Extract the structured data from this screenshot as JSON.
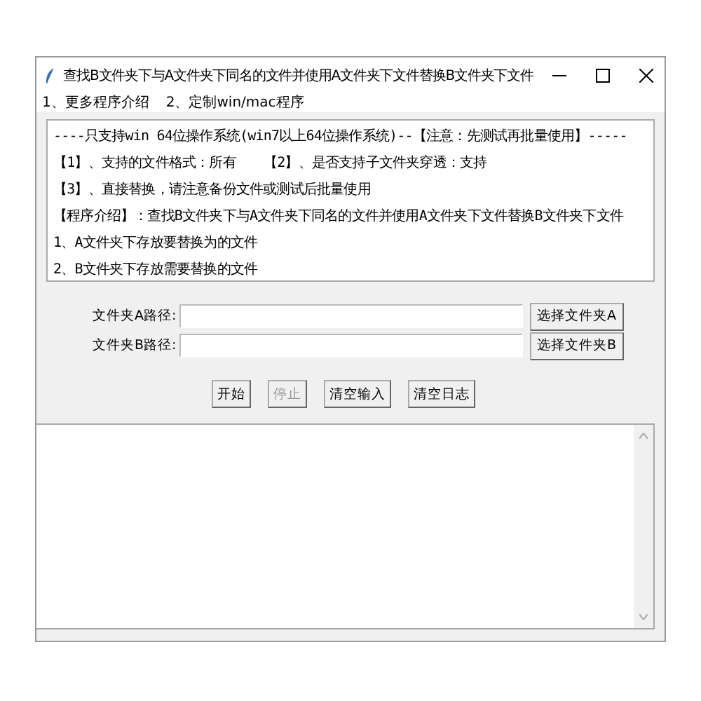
{
  "window": {
    "title": "查找B文件夹下与A文件夹下同名的文件并使用A文件夹下文件替换B文件夹下文件"
  },
  "menu": [
    "1、更多程序介绍",
    "2、定制win/mac程序"
  ],
  "info_lines": [
    "----只支持win 64位操作系统(win7以上64位操作系统)--【注意：先测试再批量使用】-----",
    "【1】、支持的文件格式：所有",
    "【3】、直接替换，请注意备份文件或测试后批量使用",
    "【程序介绍】：查找B文件夹下与A文件夹下同名的文件并使用A文件夹下文件替换B文件夹下文件",
    "1、A文件夹下存放要替换为的文件",
    "2、B文件夹下存放需要替换的文件"
  ],
  "info_line_2_right": "【2】、是否支持子文件夹穿透：支持",
  "fields": [
    {
      "label": "文件夹A路径:",
      "button": "选择文件夹A"
    },
    {
      "label": "文件夹B路径:",
      "button": "选择文件夹B"
    }
  ],
  "buttons": [
    {
      "label": "开始",
      "disabled": false
    },
    {
      "label": "停止",
      "disabled": true
    },
    {
      "label": "清空输入",
      "disabled": false
    },
    {
      "label": "清空日志",
      "disabled": false
    }
  ]
}
